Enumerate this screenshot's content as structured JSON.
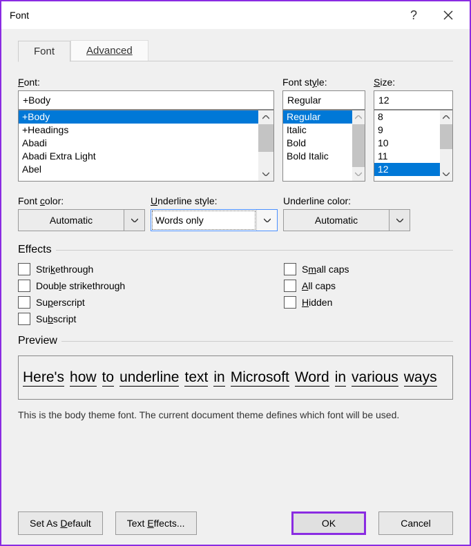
{
  "title": "Font",
  "tabs": {
    "font": "Font",
    "advanced": "Advanced"
  },
  "labels": {
    "font": "Font:",
    "fontstyle": "Font style:",
    "size": "Size:",
    "fontcolor": "Font color:",
    "ulstyle": "Underline style:",
    "ulcolor": "Underline color:",
    "effects": "Effects",
    "preview": "Preview"
  },
  "values": {
    "font": "+Body",
    "fontstyle": "Regular",
    "size": "12",
    "fontcolor": "Automatic",
    "ulstyle": "Words only",
    "ulcolor": "Automatic"
  },
  "fontlist": [
    "+Body",
    "+Headings",
    "Abadi",
    "Abadi Extra Light",
    "Abel"
  ],
  "stylelist": [
    "Regular",
    "Italic",
    "Bold",
    "Bold Italic"
  ],
  "sizelist": [
    "8",
    "9",
    "10",
    "11",
    "12"
  ],
  "effects": {
    "strike": "Strikethrough",
    "dblstrike": "Double strikethrough",
    "super": "Superscript",
    "sub": "Subscript",
    "smallcaps": "Small caps",
    "allcaps": "All caps",
    "hidden": "Hidden"
  },
  "preview_words": [
    "Here's",
    "how",
    "to",
    "underline",
    "text",
    "in",
    "Microsoft",
    "Word",
    "in",
    "various",
    "ways"
  ],
  "preview_desc": "This is the body theme font. The current document theme defines which font will be used.",
  "buttons": {
    "setdefault": "Set As Default",
    "texteffects": "Text Effects...",
    "ok": "OK",
    "cancel": "Cancel"
  }
}
